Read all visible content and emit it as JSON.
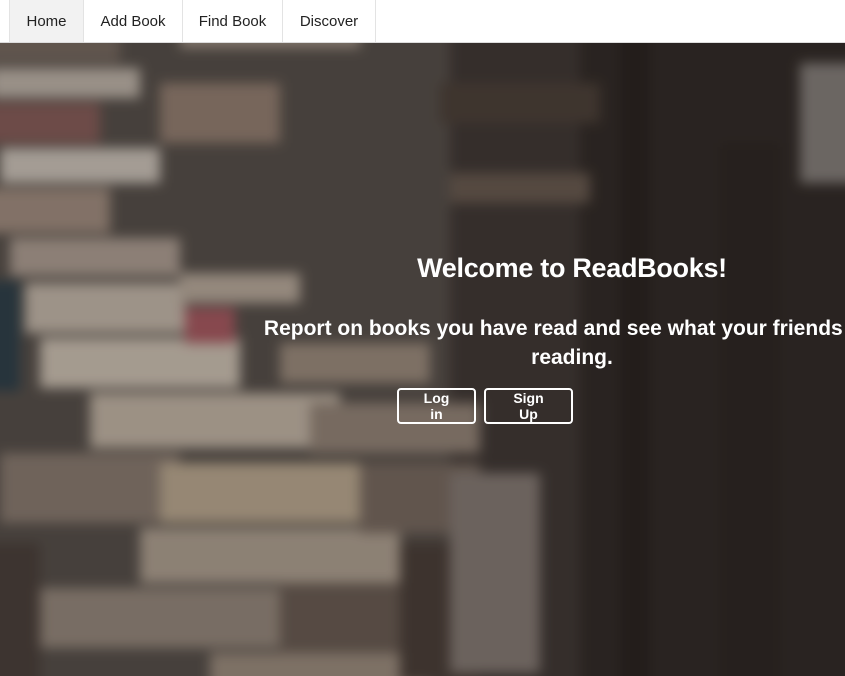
{
  "nav": {
    "items": [
      {
        "label": "Home",
        "active": true
      },
      {
        "label": "Add Book",
        "active": false
      },
      {
        "label": "Find Book",
        "active": false
      },
      {
        "label": "Discover",
        "active": false
      }
    ]
  },
  "hero": {
    "title": "Welcome to ReadBooks!",
    "subtitle": "Report on books you have read and see what your friends are reading.",
    "login_label": "Log in",
    "signup_label": "Sign Up"
  },
  "colors": {
    "nav_background": "#ffffff",
    "nav_active": "#f2f2f2",
    "hero_text": "#ffffff"
  }
}
